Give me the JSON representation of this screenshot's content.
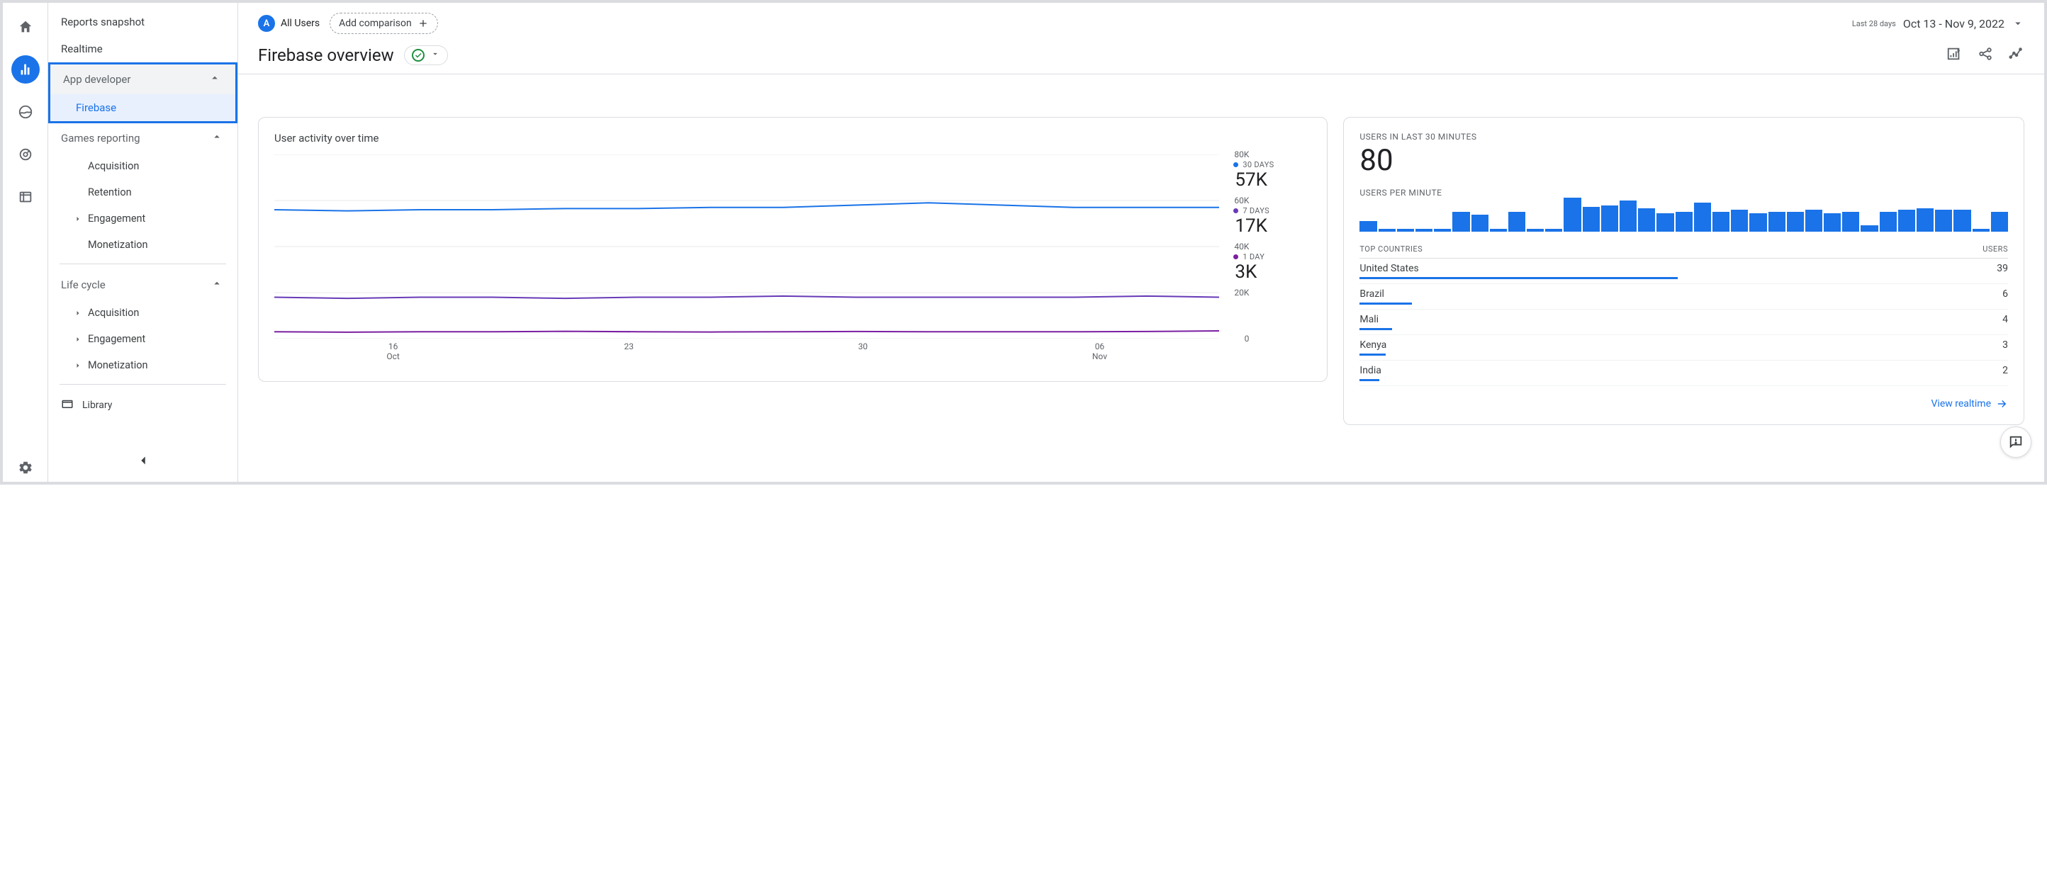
{
  "rail": {
    "items": [
      {
        "name": "home"
      },
      {
        "name": "reports",
        "active": true
      },
      {
        "name": "explore"
      },
      {
        "name": "advertising"
      },
      {
        "name": "configure"
      }
    ],
    "settings": "settings"
  },
  "sidebar": {
    "snapshot": "Reports snapshot",
    "realtime": "Realtime",
    "groups": [
      {
        "label": "App developer",
        "items": [
          {
            "label": "Firebase",
            "selected": true
          }
        ],
        "highlighted": true
      },
      {
        "label": "Games reporting",
        "items": [
          {
            "label": "Acquisition",
            "caret": false
          },
          {
            "label": "Retention",
            "caret": false
          },
          {
            "label": "Engagement",
            "caret": true
          },
          {
            "label": "Monetization",
            "caret": false
          }
        ]
      },
      {
        "label": "Life cycle",
        "items": [
          {
            "label": "Acquisition",
            "caret": true
          },
          {
            "label": "Engagement",
            "caret": true
          },
          {
            "label": "Monetization",
            "caret": true
          }
        ]
      }
    ],
    "library": "Library"
  },
  "header": {
    "audience_badge": "A",
    "audience_label": "All Users",
    "add_comparison": "Add comparison",
    "date_small": "Last 28 days",
    "date_range": "Oct 13 - Nov 9, 2022",
    "title": "Firebase overview"
  },
  "chart_data": {
    "type": "line",
    "title": "User activity over time",
    "xlabel": "",
    "ylabel": "",
    "ylim": [
      0,
      80000
    ],
    "y_ticks": [
      "80K",
      "60K",
      "40K",
      "20K",
      "0"
    ],
    "x_categories": [
      {
        "top": "16",
        "bottom": "Oct"
      },
      {
        "top": "23",
        "bottom": ""
      },
      {
        "top": "30",
        "bottom": ""
      },
      {
        "top": "06",
        "bottom": "Nov"
      }
    ],
    "series": [
      {
        "name": "30 DAYS",
        "color": "#1a73e8",
        "summary": "57K",
        "values": [
          56000,
          55500,
          56000,
          56000,
          56500,
          56500,
          57000,
          57000,
          58000,
          59000,
          58000,
          57000,
          57000,
          57000
        ]
      },
      {
        "name": "7 DAYS",
        "color": "#673ab7",
        "summary": "17K",
        "values": [
          18000,
          17500,
          18000,
          18000,
          17500,
          18000,
          18000,
          18500,
          18000,
          18000,
          18000,
          18000,
          18500,
          18000
        ]
      },
      {
        "name": "1 DAY",
        "color": "#7b1fa2",
        "summary": "3K",
        "values": [
          3000,
          2800,
          3000,
          3000,
          3200,
          3000,
          2900,
          3000,
          3100,
          3000,
          3000,
          3000,
          3100,
          3400
        ]
      }
    ]
  },
  "realtime_card": {
    "label1": "USERS IN LAST 30 MINUTES",
    "value": "80",
    "label2": "USERS PER MINUTE",
    "bars": [
      14,
      4,
      4,
      4,
      4,
      26,
      22,
      4,
      26,
      4,
      4,
      44,
      32,
      34,
      40,
      30,
      24,
      26,
      38,
      26,
      28,
      24,
      26,
      26,
      28,
      24,
      26,
      8,
      26,
      28,
      30,
      28,
      28,
      4,
      26
    ],
    "countries_head_left": "TOP COUNTRIES",
    "countries_head_right": "USERS",
    "countries": [
      {
        "name": "United States",
        "users": 39,
        "pct": 49
      },
      {
        "name": "Brazil",
        "users": 6,
        "pct": 8
      },
      {
        "name": "Mali",
        "users": 4,
        "pct": 5
      },
      {
        "name": "Kenya",
        "users": 3,
        "pct": 4
      },
      {
        "name": "India",
        "users": 2,
        "pct": 3
      }
    ],
    "link": "View realtime"
  }
}
